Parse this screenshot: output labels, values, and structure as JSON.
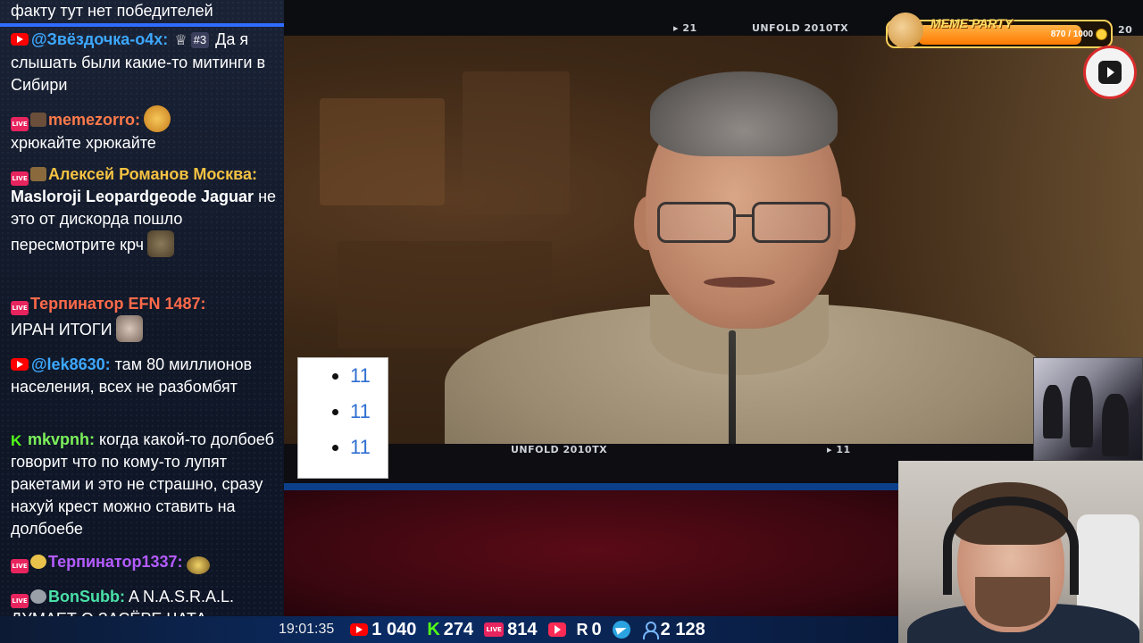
{
  "chat": {
    "messages": [
      {
        "platform": "none",
        "nick": "",
        "nick_color": "#ffffff",
        "text": "факту тут нет победителей"
      },
      {
        "platform": "youtube",
        "nick": "@Звёздочка-о4х:",
        "nick_color": "#3da8ff",
        "rank": "#3",
        "text": "Да я слышать были какие-то митинги в Сибири"
      },
      {
        "platform": "live",
        "nick": "memezorro:",
        "nick_color": "#ff7a4a",
        "text": "хрюкайте хрюкайте"
      },
      {
        "platform": "live",
        "nick": "Алексей Романов Москва:",
        "nick_color": "#f5c242",
        "text_bold": "Masloroji Leopardgeode Jaguar",
        "text": "не это от дискорда пошло пересмотрите крч"
      },
      {
        "platform": "live",
        "nick": "Терпинатор EFN 1487:",
        "nick_color": "#ff6a4a",
        "text": "ИРАН ИТОГИ"
      },
      {
        "platform": "youtube",
        "nick": "@lek8630:",
        "nick_color": "#3da8ff",
        "text": "там 80 миллионов населения, всех не разбомбят"
      },
      {
        "platform": "kick",
        "nick": "mkvpnh:",
        "nick_color": "#7cf05a",
        "text": "когда какой-то долбоеб говорит что по кому-то лупят ракетами и это не страшно, сразу нахуй крест можно ставить на долбоебе"
      },
      {
        "platform": "live",
        "nick": "Терпинатор1337:",
        "nick_color": "#b45cff",
        "text": ""
      },
      {
        "platform": "live",
        "nick": "BonSubb:",
        "nick_color": "#4ae0a8",
        "text": "A N.A.S.R.A.L. ДУМАЕТ О ЗАСЁРЕ ЧАТА"
      }
    ]
  },
  "video": {
    "top_label_num_left": "21",
    "top_label_title": "UNFOLD 2010TX",
    "top_label_num_right": "20",
    "lower_label_title": "UNFOLD 2010TX",
    "lower_label_num": "11"
  },
  "meme_party": {
    "title": "MEME PARTY",
    "count": "870 / 1000",
    "progress": 0.87
  },
  "dropdown": {
    "items": [
      "11",
      "11",
      "11"
    ]
  },
  "stats": {
    "time": "19:01:35",
    "youtube": "1 040",
    "kick": "274",
    "live": "814",
    "play": "",
    "r": "0",
    "telegram": "",
    "viewers": "2 128"
  },
  "colors": {
    "accent_blue": "#2f6cff",
    "youtube_red": "#ff0000",
    "kick_green": "#53fc18",
    "live_pink": "#e8245e"
  }
}
